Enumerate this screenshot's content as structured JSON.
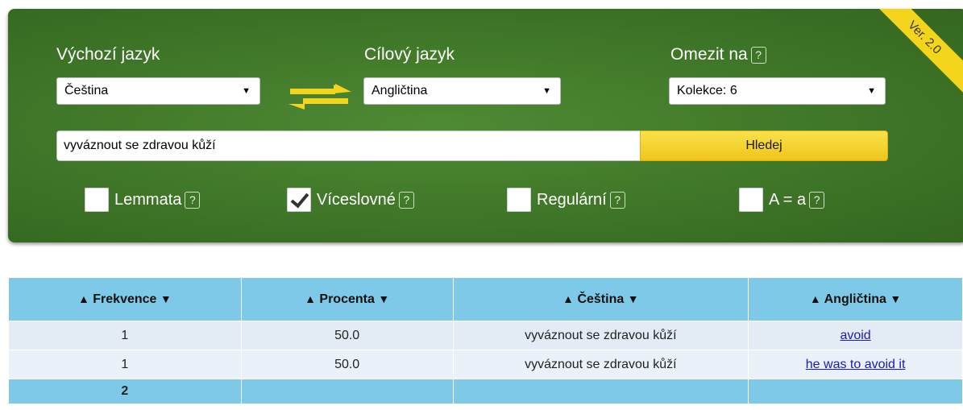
{
  "version_ribbon": "Ver. 2.0",
  "source": {
    "label": "Výchozí jazyk",
    "value": "Čeština"
  },
  "target": {
    "label": "Cílový jazyk",
    "value": "Angličtina"
  },
  "limit": {
    "label": "Omezit na",
    "help": "?",
    "value": "Kolekce: 6"
  },
  "search": {
    "value": "vyváznout se zdravou kůží",
    "button": "Hledej"
  },
  "options": [
    {
      "label": "Lemmata",
      "checked": false,
      "help": "?"
    },
    {
      "label": "Víceslovné",
      "checked": true,
      "help": "?"
    },
    {
      "label": "Regulární",
      "checked": false,
      "help": "?"
    },
    {
      "label": "A = a",
      "checked": false,
      "help": "?"
    }
  ],
  "table": {
    "headers": [
      "Frekvence",
      "Procenta",
      "Čeština",
      "Angličtina"
    ],
    "sort_up": "▲",
    "sort_down": "▼",
    "rows": [
      [
        "1",
        "50.0",
        "vyváznout se zdravou kůží",
        "avoid"
      ],
      [
        "1",
        "50.0",
        "vyváznout se zdravou kůží",
        "he was to avoid it"
      ]
    ],
    "total": "2"
  },
  "colors": {
    "panel_green": "#3f7628",
    "button_yellow": "#f3d51b",
    "header_blue": "#7ec9e7"
  }
}
